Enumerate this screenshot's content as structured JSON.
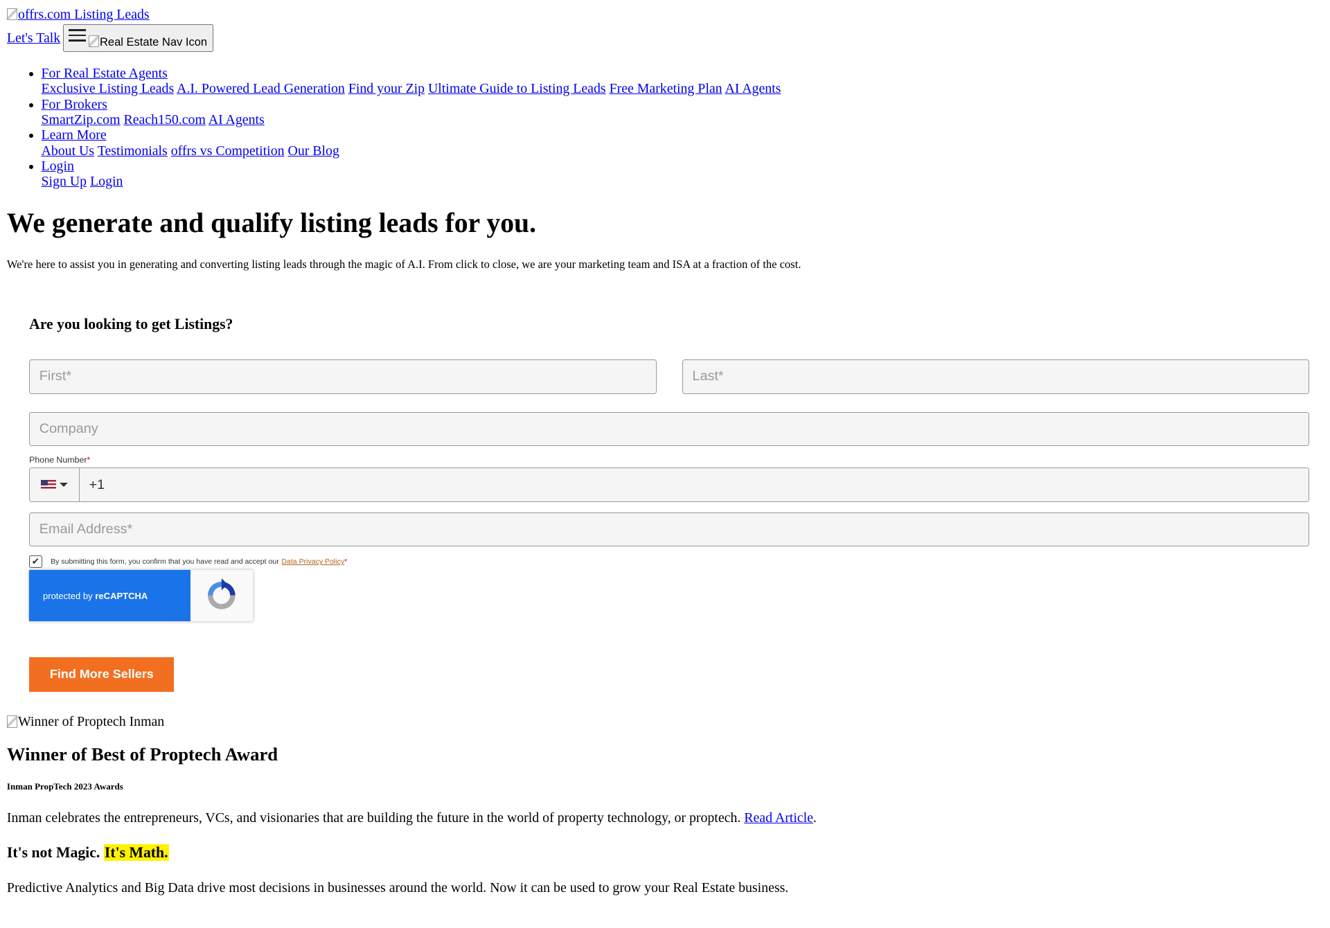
{
  "header": {
    "logo_alt": "offrs.com Listing Leads",
    "lets_talk": "Let's Talk",
    "nav_icon_alt": "Real Estate Nav Icon"
  },
  "nav": [
    {
      "label": "For Real Estate Agents",
      "links": [
        "Exclusive Listing Leads",
        "A.I. Powered Lead Generation",
        "Find your Zip",
        "Ultimate Guide to Listing Leads",
        "Free Marketing Plan",
        "AI Agents"
      ]
    },
    {
      "label": "For Brokers",
      "links": [
        "SmartZip.com",
        "Reach150.com",
        "AI Agents"
      ]
    },
    {
      "label": "Learn More",
      "links": [
        "About Us",
        "Testimonials",
        "offrs vs Competition",
        "Our Blog"
      ]
    },
    {
      "label": "Login",
      "links": [
        "Sign Up",
        "Login"
      ]
    }
  ],
  "hero": {
    "title": "We generate and qualify listing leads for you.",
    "text": "We're here to assist you in generating and converting listing leads through the magic of A.I. From click to close, we are your marketing team and ISA at a fraction of the cost."
  },
  "form": {
    "title": "Are you looking to get Listings?",
    "first_placeholder": "First*",
    "last_placeholder": "Last*",
    "company_placeholder": "Company",
    "phone_label": "Phone Number",
    "phone_required": "*",
    "phone_value": "+1",
    "email_placeholder": "Email Address*",
    "consent_text": "By submitting this form, you confirm that you have read and accept our",
    "privacy_link": "Data Privacy Policy",
    "consent_required": "*",
    "consent_checked": true,
    "recaptcha_prefix": "protected by",
    "recaptcha_brand": "reCAPTCHA",
    "submit_label": "Find More Sellers"
  },
  "award": {
    "img_alt": "Winner of Proptech Inman",
    "title": "Winner of Best of Proptech Award",
    "subtitle": "Inman PropTech 2023 Awards",
    "text": "Inman celebrates the entrepreneurs, VCs, and visionaries that are building the future in the world of property technology, or proptech.",
    "link": "Read Article",
    "link_suffix": "."
  },
  "math": {
    "title_plain": "It's not Magic.",
    "title_highlight": "It's Math.",
    "text": "Predictive Analytics and Big Data drive most decisions in businesses around the world. Now it can be used to grow your Real Estate business."
  },
  "colors": {
    "link": "#0000ee",
    "cta": "#f26f21",
    "recaptcha": "#1a73e8",
    "highlight": "#fff200"
  }
}
